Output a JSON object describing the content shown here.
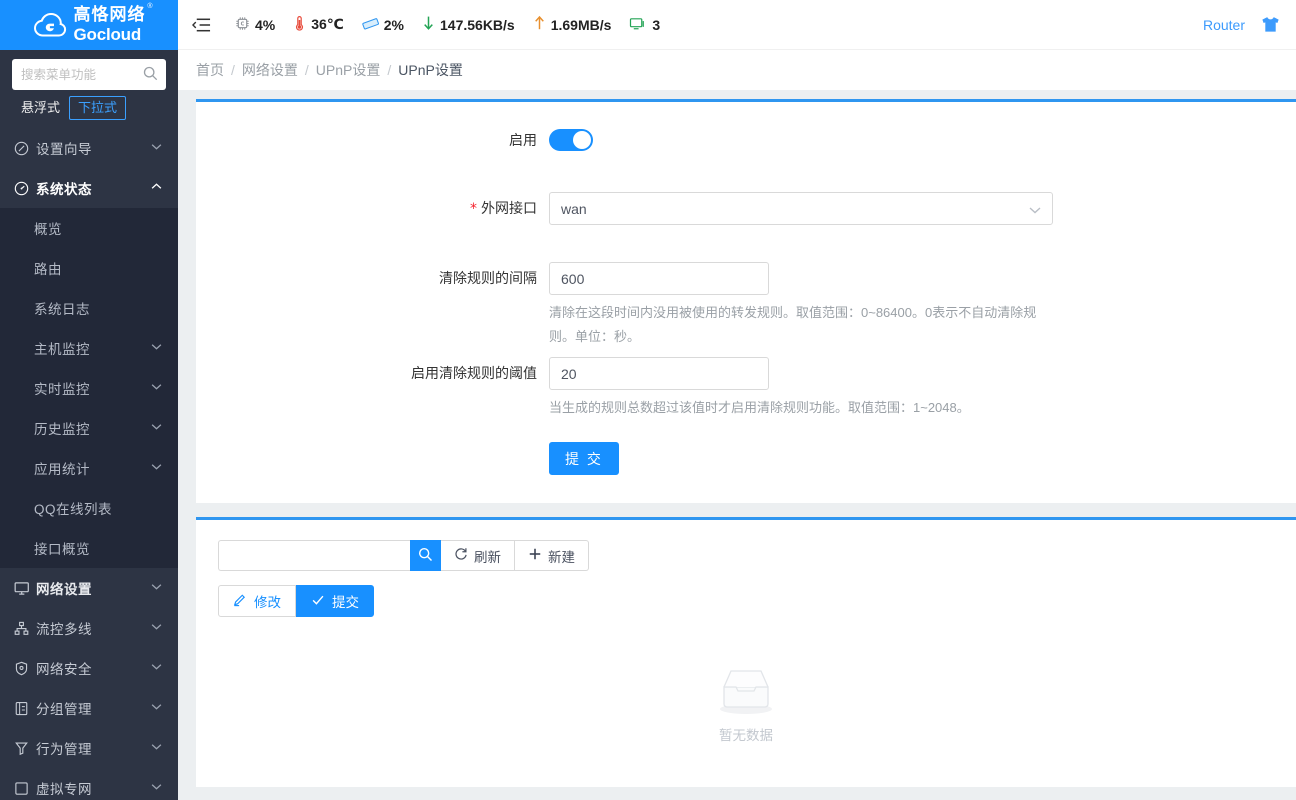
{
  "brand": {
    "cn_name": "高恪网络",
    "en_name": "Gocloud",
    "registered_mark": "®",
    "logo_bg": "#1890ff"
  },
  "sidebar": {
    "search": {
      "placeholder": "搜索菜单功能",
      "value": ""
    },
    "mode_tabs": [
      {
        "label": "悬浮式",
        "active": false
      },
      {
        "label": "下拉式",
        "active": true
      }
    ],
    "items": [
      {
        "label": "设置向导",
        "icon": "compass-icon",
        "expanded": false,
        "has_caret": true
      },
      {
        "label": "系统状态",
        "icon": "dashboard-icon",
        "expanded": true,
        "has_caret": true
      }
    ],
    "submenu": [
      {
        "label": "概览",
        "has_caret": false
      },
      {
        "label": "路由",
        "has_caret": false
      },
      {
        "label": "系统日志",
        "has_caret": false
      },
      {
        "label": "主机监控",
        "has_caret": true
      },
      {
        "label": "实时监控",
        "has_caret": true
      },
      {
        "label": "历史监控",
        "has_caret": true
      },
      {
        "label": "应用统计",
        "has_caret": true
      },
      {
        "label": "QQ在线列表",
        "has_caret": false
      },
      {
        "label": "接口概览",
        "has_caret": false
      }
    ],
    "items_bottom": [
      {
        "label": "网络设置",
        "icon": "monitor-icon",
        "active": true,
        "has_caret": true
      },
      {
        "label": "流控多线",
        "icon": "flow-icon",
        "active": false,
        "has_caret": true
      },
      {
        "label": "网络安全",
        "icon": "shield-icon",
        "active": false,
        "has_caret": true
      },
      {
        "label": "分组管理",
        "icon": "group-icon",
        "active": false,
        "has_caret": true
      },
      {
        "label": "行为管理",
        "icon": "filter-icon",
        "active": false,
        "has_caret": true
      },
      {
        "label": "虚拟专网",
        "icon": "vpn-icon",
        "active": false,
        "has_caret": true
      }
    ]
  },
  "topbar": {
    "collapse_icon": "menu-collapse-icon",
    "stats": [
      {
        "icon": "cpu-icon",
        "value": "4%"
      },
      {
        "icon": "thermometer-icon",
        "value": "36℃"
      },
      {
        "icon": "memory-icon",
        "value": "2%"
      },
      {
        "icon": "download-arrow-icon",
        "value": "147.56KB/s"
      },
      {
        "icon": "upload-arrow-icon",
        "value": "1.69MB/s"
      },
      {
        "icon": "devices-icon",
        "value": "3"
      }
    ],
    "router_label": "Router",
    "skin_icon": "skin-shirt-icon"
  },
  "breadcrumb": {
    "separator": "/",
    "items": [
      {
        "label": "首页",
        "last": false
      },
      {
        "label": "网络设置",
        "last": false
      },
      {
        "label": "UPnP设置",
        "last": false
      },
      {
        "label": "UPnP设置",
        "last": true
      }
    ]
  },
  "form": {
    "enable": {
      "label": "启用",
      "on": true
    },
    "wan_interface": {
      "label": "外网接口",
      "required": true,
      "value": "wan",
      "options": [
        "wan"
      ]
    },
    "clear_interval": {
      "label": "清除规则的间隔",
      "value": "600",
      "hint": "清除在这段时间内没用被使用的转发规则。取值范围：0~86400。0表示不自动清除规则。单位：秒。"
    },
    "clear_threshold": {
      "label": "启用清除规则的阈值",
      "value": "20",
      "hint": "当生成的规则总数超过该值时才启用清除规则功能。取值范围：1~2048。"
    },
    "submit_label": "提 交"
  },
  "table_panel": {
    "search": {
      "value": "",
      "placeholder": ""
    },
    "search_button_icon": "search-icon",
    "buttons": [
      {
        "label": "刷新",
        "icon": "refresh-icon",
        "style": "outline"
      },
      {
        "label": "新建",
        "icon": "plus-icon",
        "style": "outline"
      }
    ],
    "action_buttons": [
      {
        "label": "修改",
        "icon": "pencil-icon",
        "style": "outline"
      },
      {
        "label": "提交",
        "icon": "check-icon",
        "style": "filled"
      }
    ],
    "empty_text": "暂无数据",
    "empty_icon": "empty-box-icon"
  },
  "colors": {
    "accent": "#1890ff",
    "card_top_border": "#2f96f0",
    "sidebar_bg": "#2d3444",
    "submenu_bg": "#222838",
    "page_bg": "#eceff1",
    "required_star": "#f5222d"
  }
}
